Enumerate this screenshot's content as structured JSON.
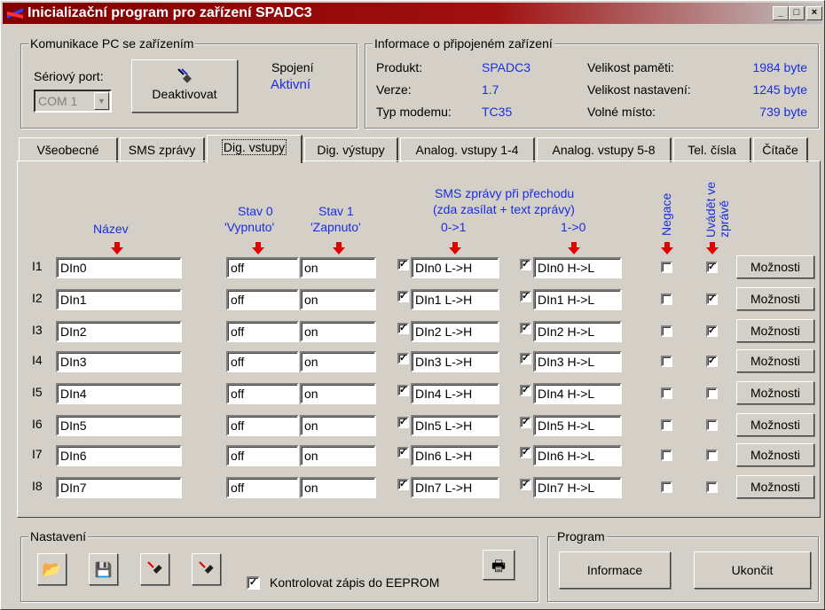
{
  "window": {
    "title": "Inicializační program pro zařízení SPADC3"
  },
  "comm": {
    "group_title": "Komunikace PC se zařízením",
    "port_label": "Sériový port:",
    "port_value": "COM 1",
    "deactivate_label": "Deaktivovat",
    "conn_label": "Spojení",
    "conn_status": "Aktivní"
  },
  "info": {
    "group_title": "Informace o připojeném zařízení",
    "rows": [
      {
        "label": "Produkt:",
        "value": "SPADC3",
        "label2": "Velikost paměti:",
        "value2": "1984 byte"
      },
      {
        "label": "Verze:",
        "value": "1.7",
        "label2": "Velikost nastavení:",
        "value2": "1245 byte"
      },
      {
        "label": "Typ modemu:",
        "value": "TC35",
        "label2": "Volné místo:",
        "value2": "739 byte"
      }
    ]
  },
  "tabs": [
    "Všeobecné",
    "SMS zprávy",
    "Dig. vstupy",
    "Dig. výstupy",
    "Analog. vstupy 1-4",
    "Analog. vstupy 5-8",
    "Tel. čísla",
    "Čítače"
  ],
  "active_tab": "Dig. vstupy",
  "headers": {
    "name": "Název",
    "state0": "Stav 0",
    "state0b": "'Vypnuto'",
    "state1": "Stav 1",
    "state1b": "'Zapnuto'",
    "sms1": "SMS zprávy při přechodu",
    "sms2": "(zda zasílat + text zprávy)",
    "t01": "0->1",
    "t10": "1->0",
    "neg": "Negace",
    "show": "Uvádět ve zprávě"
  },
  "rows": [
    {
      "id": "I1",
      "name": "DIn0",
      "off": "off",
      "on": "on",
      "lh": "DIn0 L->H",
      "hl": "DIn0 H->L",
      "neg": false,
      "show": true
    },
    {
      "id": "I2",
      "name": "DIn1",
      "off": "off",
      "on": "on",
      "lh": "DIn1 L->H",
      "hl": "DIn1 H->L",
      "neg": false,
      "show": true
    },
    {
      "id": "I3",
      "name": "DIn2",
      "off": "off",
      "on": "on",
      "lh": "DIn2 L->H",
      "hl": "DIn2 H->L",
      "neg": false,
      "show": true
    },
    {
      "id": "I4",
      "name": "DIn3",
      "off": "off",
      "on": "on",
      "lh": "DIn3 L->H",
      "hl": "DIn3 H->L",
      "neg": false,
      "show": true
    },
    {
      "id": "I5",
      "name": "DIn4",
      "off": "off",
      "on": "on",
      "lh": "DIn4 L->H",
      "hl": "DIn4 H->L",
      "neg": false,
      "show": false
    },
    {
      "id": "I6",
      "name": "DIn5",
      "off": "off",
      "on": "on",
      "lh": "DIn5 L->H",
      "hl": "DIn5 H->L",
      "neg": false,
      "show": false
    },
    {
      "id": "I7",
      "name": "DIn6",
      "off": "off",
      "on": "on",
      "lh": "DIn6 L->H",
      "hl": "DIn6 H->L",
      "neg": false,
      "show": false
    },
    {
      "id": "I8",
      "name": "DIn7",
      "off": "off",
      "on": "on",
      "lh": "DIn7 L->H",
      "hl": "DIn7 H->L",
      "neg": false,
      "show": false
    }
  ],
  "options_label": "Možnosti",
  "settings": {
    "group_title": "Nastavení",
    "eeprom_label": "Kontrolovat zápis do EEPROM",
    "eeprom_checked": true
  },
  "program": {
    "group_title": "Program",
    "info_label": "Informace",
    "exit_label": "Ukončit"
  },
  "colors": {
    "title_bar": "#800000",
    "accent_text": "#1a2ee0",
    "arrow": "#e00000"
  }
}
